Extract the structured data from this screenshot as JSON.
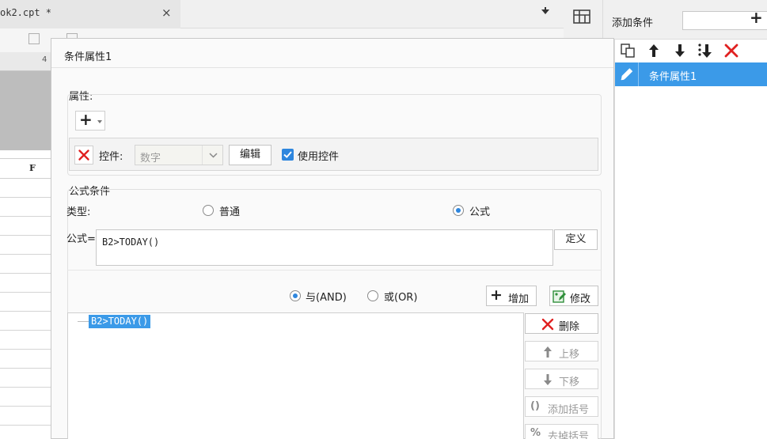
{
  "background": {
    "tab_title": "ok2.cpt *",
    "tab_close": "×",
    "ruler_number": "4",
    "column_letter": "F"
  },
  "right_panel": {
    "title": "添加条件",
    "add_glyph": "+",
    "tools": [
      "copy-icon",
      "arrow-up-icon",
      "arrow-down-icon",
      "move-bottom-icon",
      "delete-icon"
    ],
    "items": [
      {
        "label": "条件属性1",
        "selected": true
      }
    ]
  },
  "dialog": {
    "title": "条件属性1",
    "attributes": {
      "label": "属性:",
      "add_glyph": "+",
      "control_label": "控件:",
      "control_value": "数字",
      "edit_button": "编辑",
      "use_control_label": "使用控件",
      "use_control_checked": true
    },
    "formula_condition": {
      "label": "公式条件",
      "type_label": "类型:",
      "type_options": [
        {
          "label": "普通",
          "selected": false
        },
        {
          "label": "公式",
          "selected": true
        }
      ],
      "formula_label": "公式=",
      "formula_value": "B2>TODAY()",
      "define_button": "定义",
      "logic_options": [
        {
          "label": "与(AND)",
          "selected": true
        },
        {
          "label": "或(OR)",
          "selected": false
        }
      ],
      "add_button": "增加",
      "modify_button": "修改",
      "conditions": [
        "B2>TODAY()"
      ],
      "side_buttons": [
        {
          "label": "删除",
          "icon": "delete-icon",
          "enabled": true
        },
        {
          "label": "上移",
          "icon": "arrow-up-icon",
          "enabled": false
        },
        {
          "label": "下移",
          "icon": "arrow-down-icon",
          "enabled": false
        },
        {
          "label": "添加括号",
          "icon": "parentheses-icon",
          "enabled": false
        },
        {
          "label": "去掉括号",
          "icon": "remove-parentheses-icon",
          "enabled": false
        }
      ]
    }
  },
  "colors": {
    "accent": "#3b9ae8",
    "checkbox": "#2e86de",
    "delete_red": "#e02020",
    "disabled_text": "#9a9a9a"
  }
}
